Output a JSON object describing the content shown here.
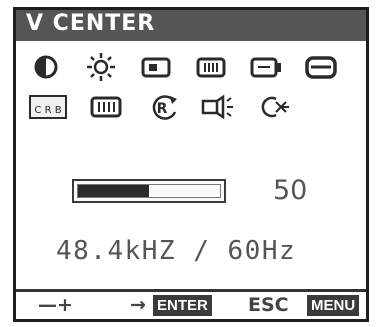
{
  "title": "V CENTER",
  "icons_row1": [
    "contrast-icon",
    "brightness-icon",
    "h-position-icon",
    "h-size-icon",
    "v-position-icon",
    "v-center-icon"
  ],
  "icons_row2": [
    "color-temp-icon",
    "moire-icon",
    "recall-icon",
    "degauss-icon",
    "osd-icon"
  ],
  "color_temp_label": "C R B",
  "slider": {
    "value": "50",
    "fraction": 0.5
  },
  "frequency": "48.4kHZ / 60Hz",
  "footer": {
    "adjust_label": "—+",
    "arrow_label": "→",
    "enter_label": "ENTER",
    "esc_label": "ESC",
    "menu_label": "MENU"
  },
  "colors": {
    "frame": "#1e1e1e",
    "title_bg": "#555555",
    "badge_bg": "#3a3a3a"
  }
}
